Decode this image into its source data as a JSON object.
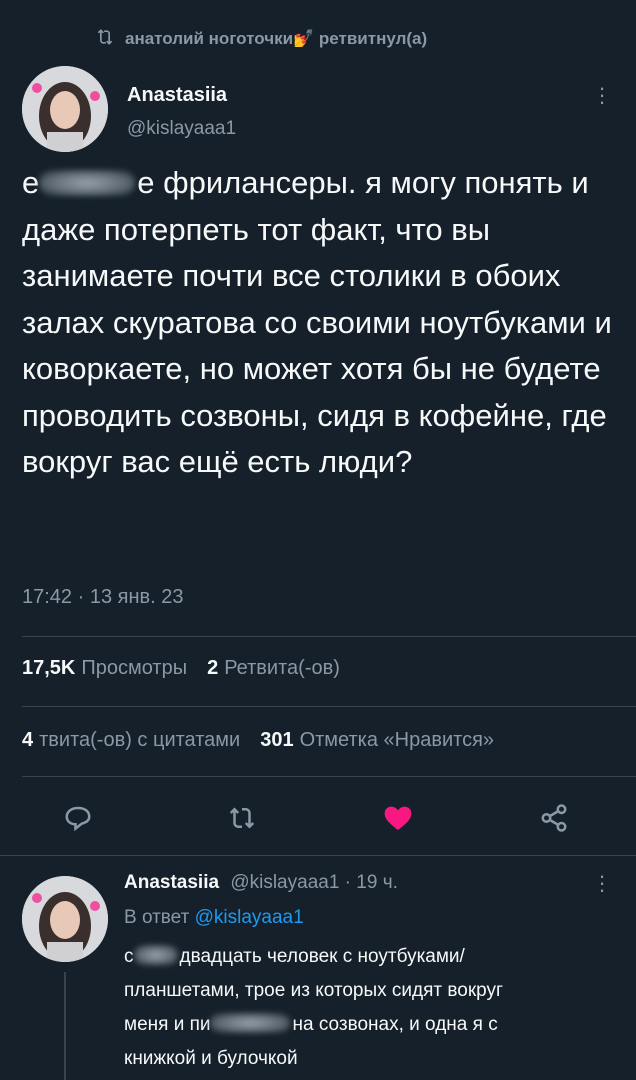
{
  "retweet_bar": {
    "text": "анатолий ноготочки💅 ретвитнул(а)"
  },
  "tweet": {
    "name": "Anastasiia",
    "handle": "@kislayaaa1",
    "text_prefix": "е",
    "text_rest": "е фрилансеры. я могу понять и даже потерпеть тот факт, что вы занимаете почти все столики в обоих залах скуратова со своими ноутбуками и коворкаете, но может хотя бы не будете проводить созвоны, сидя в кофейне, где вокруг вас ещё есть люди?",
    "timestamp": "17:42 · 13 янв. 23",
    "views_count": "17,5K",
    "views_label": "Просмотры",
    "retweets_count": "2",
    "retweets_label": "Ретвита(-ов)",
    "quotes_count": "4",
    "quotes_label": "твита(-ов) с цитатами",
    "likes_count": "301",
    "likes_label": "Отметка «Нравится»"
  },
  "reply": {
    "name": "Anastasiia",
    "handle_time": "@kislayaaa1 · 19 ч.",
    "in_reply_prefix": "В ответ",
    "in_reply_handle": "@kislayaaa1",
    "line1_prefix": "с",
    "line1_rest": "двадцать человек с ноутбуками/",
    "line2": "планшетами, трое из которых сидят вокруг",
    "line3_prefix": "меня и пи",
    "line3_rest": "на созвонах, и одна я с",
    "line4": "книжкой и булочкой"
  },
  "colors": {
    "background": "#15202b",
    "like": "#f91880",
    "link": "#1d9bf0",
    "muted": "#8b98a5"
  },
  "icons": [
    "retweet-icon",
    "more-icon",
    "reply-icon",
    "heart-icon",
    "share-icon"
  ]
}
